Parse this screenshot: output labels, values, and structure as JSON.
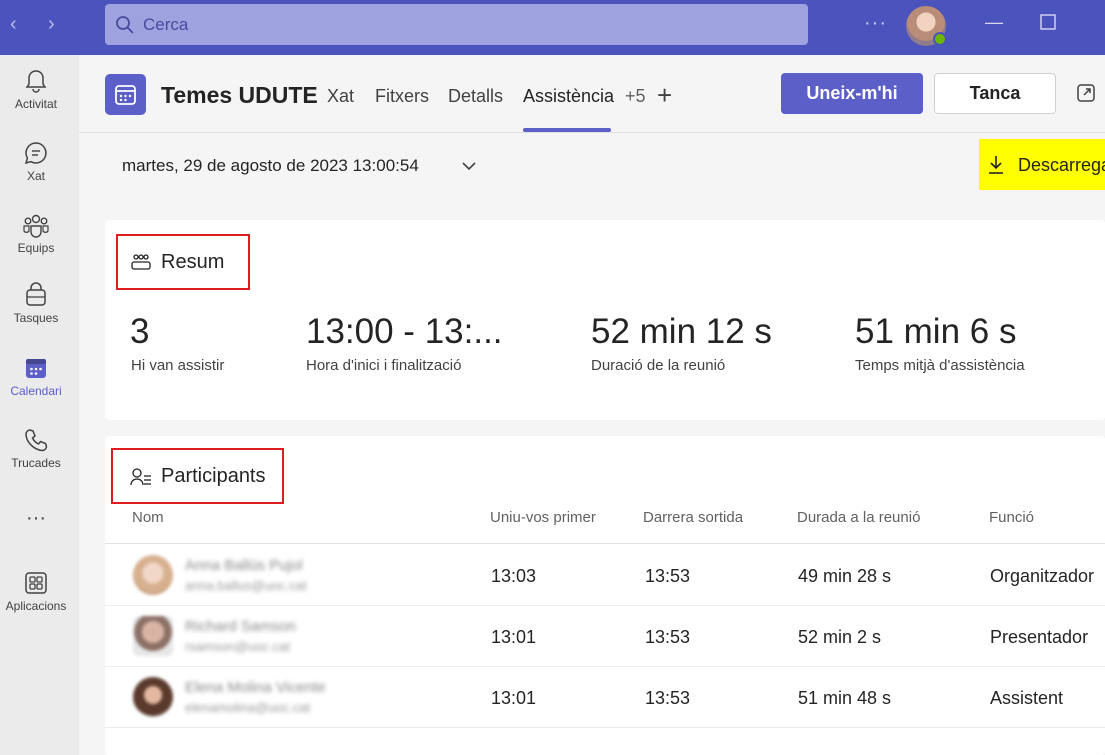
{
  "topbar": {
    "search_placeholder": "Cerca",
    "more": "···",
    "back_arrow": "‹",
    "forward_arrow": "›"
  },
  "rail": {
    "items": [
      {
        "label": "Activitat",
        "icon": "bell-icon"
      },
      {
        "label": "Xat",
        "icon": "chat-icon"
      },
      {
        "label": "Equips",
        "icon": "teams-icon"
      },
      {
        "label": "Tasques",
        "icon": "tasks-icon"
      },
      {
        "label": "Calendari",
        "icon": "calendar-icon",
        "active": true
      },
      {
        "label": "Trucades",
        "icon": "phone-icon"
      },
      {
        "label": "···",
        "icon": "more-icon"
      },
      {
        "label": "Aplicacions",
        "icon": "apps-icon"
      }
    ]
  },
  "header": {
    "title": "Temes UDUTE",
    "tabs": [
      {
        "label": "Xat"
      },
      {
        "label": "Fitxers"
      },
      {
        "label": "Detalls"
      },
      {
        "label": "Assistència",
        "active": true
      },
      {
        "label": "+5"
      }
    ],
    "join_label": "Uneix-m'hi",
    "close_label": "Tanca"
  },
  "date_row": {
    "date": "martes, 29 de agosto de 2023 13:00:54",
    "download_label": "Descarrega"
  },
  "summary": {
    "title": "Resum",
    "stats": [
      {
        "value": "3",
        "label": "Hi van assistir"
      },
      {
        "value": "13:00 - 13:...",
        "label": "Hora d'inici i finalització"
      },
      {
        "value": "52 min 12 s",
        "label": "Duració de la reunió"
      },
      {
        "value": "51 min 6 s",
        "label": "Temps mitjà d'assistència"
      }
    ]
  },
  "participants": {
    "title": "Participants",
    "columns": [
      "Nom",
      "Uniu-vos primer",
      "Darrera sortida",
      "Durada a la reunió",
      "Funció"
    ],
    "rows": [
      {
        "name": "Anna Ballús Pujol",
        "email": "anna.ballus@uoc.cat",
        "first_join": "13:03",
        "last_leave": "13:53",
        "duration": "49 min 28 s",
        "role": "Organitzador"
      },
      {
        "name": "Richard Samson",
        "email": "rsamson@uoc.cat",
        "first_join": "13:01",
        "last_leave": "13:53",
        "duration": "52 min 2 s",
        "role": "Presentador"
      },
      {
        "name": "Elena Molina Vicente",
        "email": "elenamolina@uoc.cat",
        "first_join": "13:01",
        "last_leave": "13:53",
        "duration": "51 min 48 s",
        "role": "Assistent"
      }
    ]
  },
  "colors": {
    "brand": "#4b53bc",
    "accent": "#5b5fc7",
    "highlight": "#ffff00",
    "annotation": "#e01d1d"
  }
}
